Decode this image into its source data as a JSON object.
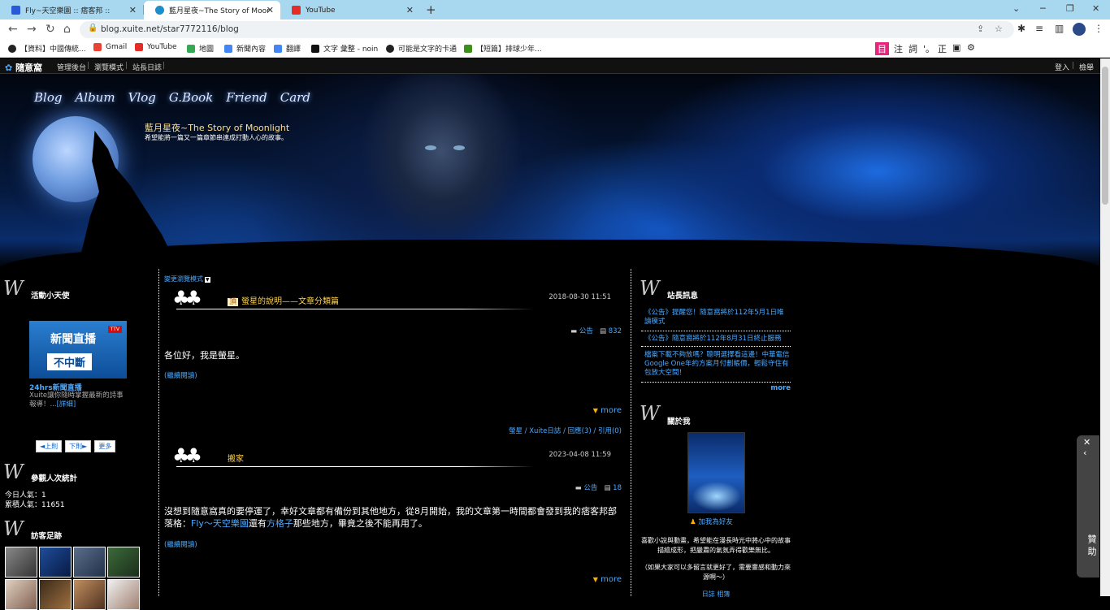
{
  "browser": {
    "tabs": [
      {
        "title": "Fly~天空樂園 :: 痞客邦 ::",
        "color": "#2a5bd7"
      },
      {
        "title": "藍月星夜~The Story of Moonlight",
        "color": "#1a8fcc"
      },
      {
        "title": "YouTube",
        "color": "#e52d27"
      }
    ],
    "url": "blog.xuite.net/star7772116/blog",
    "bookmarks": [
      "【資料】中國傳統...",
      "Gmail",
      "YouTube",
      "地圖",
      "新聞內容",
      "翻譯",
      "文字 彙整 - noin",
      "可能是文字的卡通",
      "【短篇】排球少年..."
    ],
    "ext_icons": [
      "注",
      "詞",
      "'。",
      "正"
    ]
  },
  "xuitebar": {
    "logo": "隨意窩",
    "links": [
      "管理後台",
      "瀏覽模式",
      "站長日誌"
    ],
    "right": [
      "登入",
      "檢舉"
    ]
  },
  "banner": {
    "nav": [
      "Blog",
      "Album",
      "Vlog",
      "G.Book",
      "Friend",
      "Card"
    ],
    "title": "藍月星夜~The Story of Moonlight",
    "subtitle": "希望能將一篇又一篇章節串連成打動人心的故事。"
  },
  "left": {
    "angel_title": "活動小天使",
    "angel_img_line1": "新聞直播",
    "angel_img_line2": "不中斷",
    "angel_img_badge": "TTV",
    "angel_name": "24hrs新聞直播",
    "angel_desc": "Xuite讓你隨時掌握最新的詩事報導！...",
    "angel_more": "[詳細]",
    "pager": [
      "◄上則",
      "下則►",
      "更多"
    ],
    "counter_title": "參觀人次統計",
    "today": "今日人氣：1",
    "total": "累積人氣：11651",
    "visitors_title": "訪客足跡"
  },
  "main": {
    "change_mode": "變更瀏覽模式",
    "posts": [
      {
        "title": "螢星的說明——文章分類篇",
        "date": "2018-08-30 11:51",
        "category": "公告",
        "views": "832",
        "body": "各位好，我是螢星。",
        "readmore": "(繼續閱讀)",
        "more": "more",
        "footer": "螢星 / Xuite日誌 / 回應(3) / 引用(0)"
      },
      {
        "title": "搬家",
        "date": "2023-04-08 11:59",
        "category": "公告",
        "views": "18",
        "body_pre": "沒想到隨意窩真的要停運了，幸好文章都有備份到其他地方，從8月開始，我的文章第一時間都會發到我的痞客邦部落格：",
        "link1": "Fly～天空樂園",
        "body_mid": "還有",
        "link2": "方格子",
        "body_post": "那些地方，畢竟之後不能再用了。",
        "readmore": "(繼續閱讀)",
        "more": "more"
      }
    ]
  },
  "right": {
    "notice_title": "站長訊息",
    "notices": [
      "《公告》提醒您！隨意窩將於112年5月1日唯讀模式",
      "《公告》隨意窩將於112年8月31日終止服務",
      "檔案下載不夠放嗎？聰明選擇看這邊！中華電信Google One年約方案月付劃帳價，輕鬆守住有包放大空間！"
    ],
    "notice_more": "more",
    "about_title": "關於我",
    "add_friend": "加我為好友",
    "about_text1": "喜歡小說與動畫，希望能在漫長時光中將心中的故事描繪成形，把嚴肅的氣氛弄得歡樂無比。",
    "about_text2": "（如果大家可以多留言就更好了，需要靈感和動力來源啊～）",
    "about_links": "日誌 相簿"
  },
  "sidepanel": {
    "label": "贊助"
  }
}
